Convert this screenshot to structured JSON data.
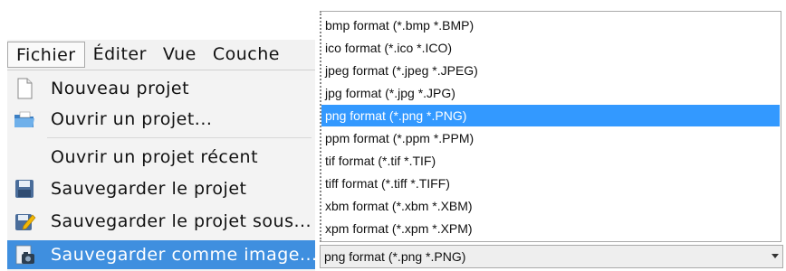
{
  "menubar": {
    "items": [
      "Fichier",
      "Éditer",
      "Vue",
      "Couche"
    ]
  },
  "file_menu": {
    "items": [
      {
        "label": "Nouveau projet",
        "icon": "new-document-icon"
      },
      {
        "label": "Ouvrir un projet...",
        "icon": "open-folder-icon"
      },
      {
        "label": "Ouvrir un projet récent",
        "icon": ""
      },
      {
        "label": "Sauvegarder le projet",
        "icon": "save-icon"
      },
      {
        "label": "Sauvegarder le projet sous...",
        "icon": "save-as-icon"
      },
      {
        "label": "Sauvegarder comme image...",
        "icon": "save-image-icon"
      }
    ],
    "highlight_color": "#3f8fdf"
  },
  "format_list": {
    "items": [
      "bmp format (*.bmp *.BMP)",
      "ico format (*.ico *.ICO)",
      "jpeg format (*.jpeg *.JPEG)",
      "jpg format (*.jpg *.JPG)",
      "png format (*.png *.PNG)",
      "ppm format (*.ppm *.PPM)",
      "tif format (*.tif *.TIF)",
      "tiff format (*.tiff *.TIFF)",
      "xbm format (*.xbm *.XBM)",
      "xpm format (*.xpm *.XPM)"
    ],
    "selected_color": "#3399ff"
  },
  "format_combo": {
    "value": "png format (*.png *.PNG)"
  }
}
